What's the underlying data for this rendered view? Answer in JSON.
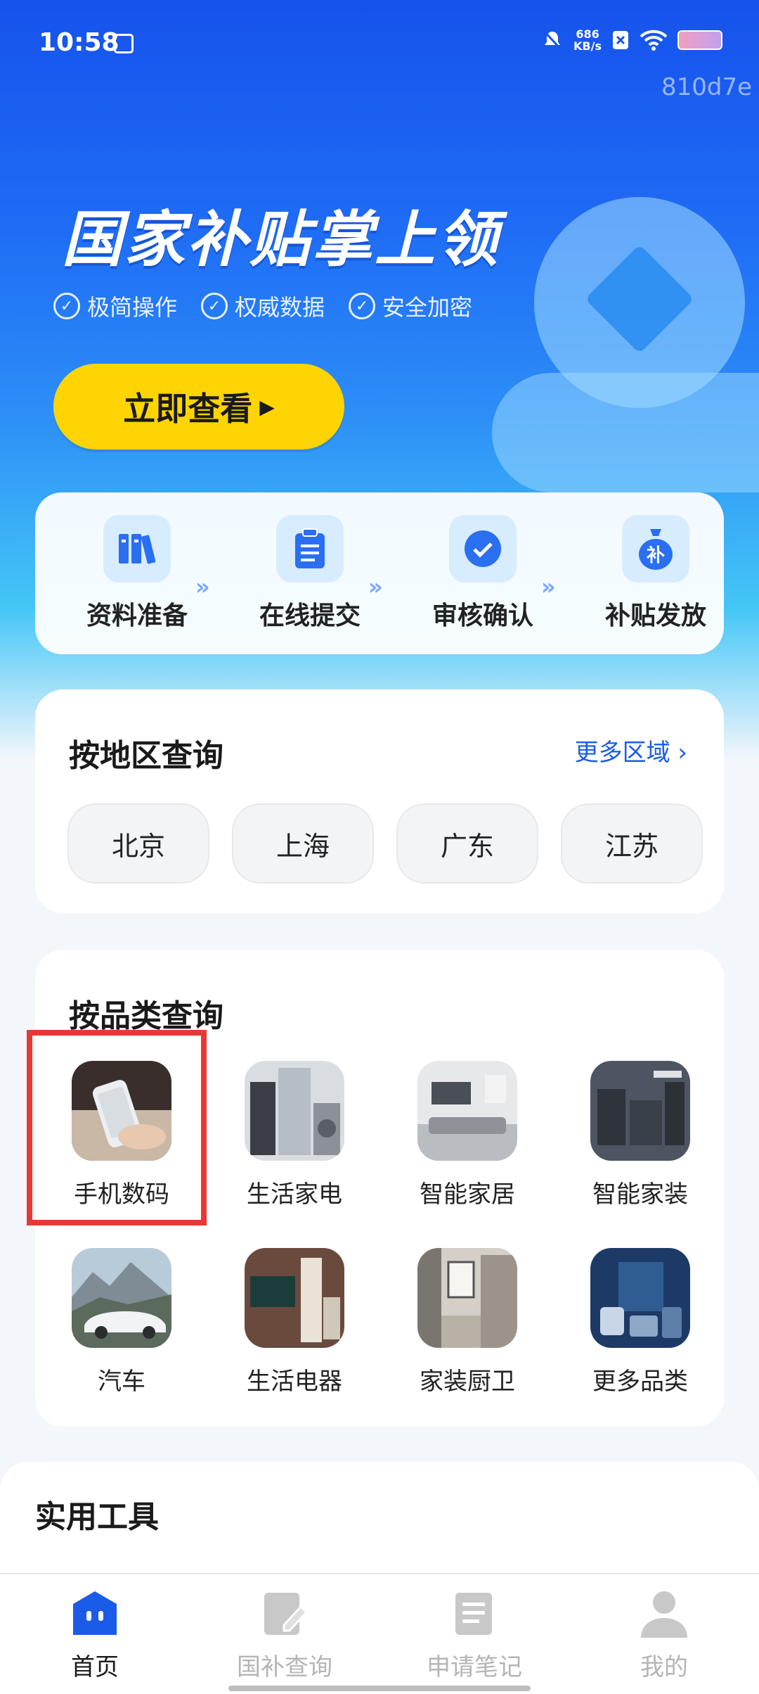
{
  "status_bar": {
    "time": "10:58",
    "net_speed": "686",
    "net_unit": "KB/s"
  },
  "watermark": "810d7e",
  "hero": {
    "title": "国家补贴掌上领",
    "tags": [
      "极简操作",
      "权威数据",
      "安全加密"
    ],
    "cta_label": "立即查看"
  },
  "steps": [
    {
      "label": "资料准备",
      "icon": "books-icon"
    },
    {
      "label": "在线提交",
      "icon": "clipboard-icon"
    },
    {
      "label": "审核确认",
      "icon": "check-badge-icon"
    },
    {
      "label": "补贴发放",
      "icon": "money-bag-icon",
      "icon_text": "补"
    }
  ],
  "region": {
    "title": "按地区查询",
    "more": "更多区域",
    "chips": [
      "北京",
      "上海",
      "广东",
      "江苏"
    ]
  },
  "category": {
    "title": "按品类查询",
    "items": [
      {
        "label": "手机数码",
        "icon": "phone-digital-image"
      },
      {
        "label": "生活家电",
        "icon": "home-appliance-image"
      },
      {
        "label": "智能家居",
        "icon": "smart-home-image"
      },
      {
        "label": "智能家装",
        "icon": "smart-decor-image"
      },
      {
        "label": "汽车",
        "icon": "car-image"
      },
      {
        "label": "生活电器",
        "icon": "living-appliance-image"
      },
      {
        "label": "家装厨卫",
        "icon": "kitchen-bath-image"
      },
      {
        "label": "更多品类",
        "icon": "more-categories-image"
      }
    ],
    "highlighted_index": 0
  },
  "tools": {
    "title": "实用工具"
  },
  "tabbar": [
    {
      "label": "首页",
      "icon": "home-icon",
      "active": true
    },
    {
      "label": "国补查询",
      "icon": "query-edit-icon",
      "active": false
    },
    {
      "label": "申请笔记",
      "icon": "notes-icon",
      "active": false
    },
    {
      "label": "我的",
      "icon": "profile-icon",
      "active": false
    }
  ],
  "colors": {
    "primary": "#1a5ce8",
    "cta": "#ffd400",
    "highlight": "#e53935"
  }
}
